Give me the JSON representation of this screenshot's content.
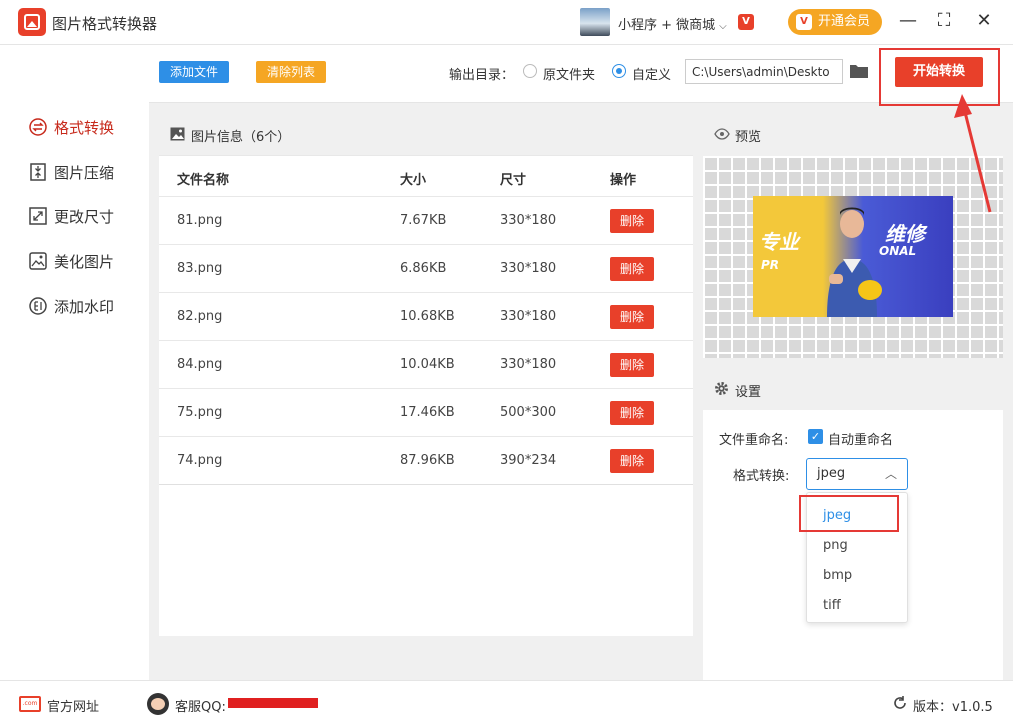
{
  "window": {
    "title": "图片格式转换器",
    "mini_program": "小程序 + 微商城",
    "vip_mark": "V",
    "member_button": "开通会员",
    "minimize": "—",
    "maximize": "⛶",
    "close": "✕"
  },
  "sidebar": {
    "items": [
      {
        "label": "格式转换",
        "active": true
      },
      {
        "label": "图片压缩",
        "active": false
      },
      {
        "label": "更改尺寸",
        "active": false
      },
      {
        "label": "美化图片",
        "active": false
      },
      {
        "label": "添加水印",
        "active": false
      }
    ]
  },
  "toolbar": {
    "add_files": "添加文件",
    "clear_list": "清除列表",
    "output_label": "输出目录：",
    "option_source": "原文件夹",
    "option_custom": "自定义",
    "output_path": "C:\\Users\\admin\\Deskto",
    "start_button": "开始转换"
  },
  "file_list": {
    "header": "图片信息（6个）",
    "columns": [
      "文件名称",
      "大小",
      "尺寸",
      "操作"
    ],
    "rows": [
      {
        "name": "81.png",
        "size": "7.67KB",
        "dimensions": "330*180",
        "action": "删除"
      },
      {
        "name": "83.png",
        "size": "6.86KB",
        "dimensions": "330*180",
        "action": "删除"
      },
      {
        "name": "82.png",
        "size": "10.68KB",
        "dimensions": "330*180",
        "action": "删除"
      },
      {
        "name": "84.png",
        "size": "10.04KB",
        "dimensions": "330*180",
        "action": "删除"
      },
      {
        "name": "75.png",
        "size": "17.46KB",
        "dimensions": "500*300",
        "action": "删除"
      },
      {
        "name": "74.png",
        "size": "87.96KB",
        "dimensions": "390*234",
        "action": "删除"
      }
    ]
  },
  "preview": {
    "header": "预览",
    "image_text": [
      "专业",
      "维修",
      "PR",
      "ONAL"
    ]
  },
  "settings": {
    "header": "设置",
    "rename_label": "文件重命名:",
    "auto_rename": "自动重命名",
    "auto_rename_checked": true,
    "format_label": "格式转换:",
    "format_value": "jpeg",
    "format_options": [
      "jpeg",
      "png",
      "bmp",
      "tiff"
    ]
  },
  "footer": {
    "website": "官方网址",
    "website_icon_text": ".com",
    "support_qq": "客服QQ:",
    "version": "版本：v1.0.5"
  },
  "colors": {
    "accent_red": "#e8402a",
    "accent_blue": "#2e8fe6",
    "accent_orange": "#f5a623",
    "annotation_red": "#e53935"
  }
}
